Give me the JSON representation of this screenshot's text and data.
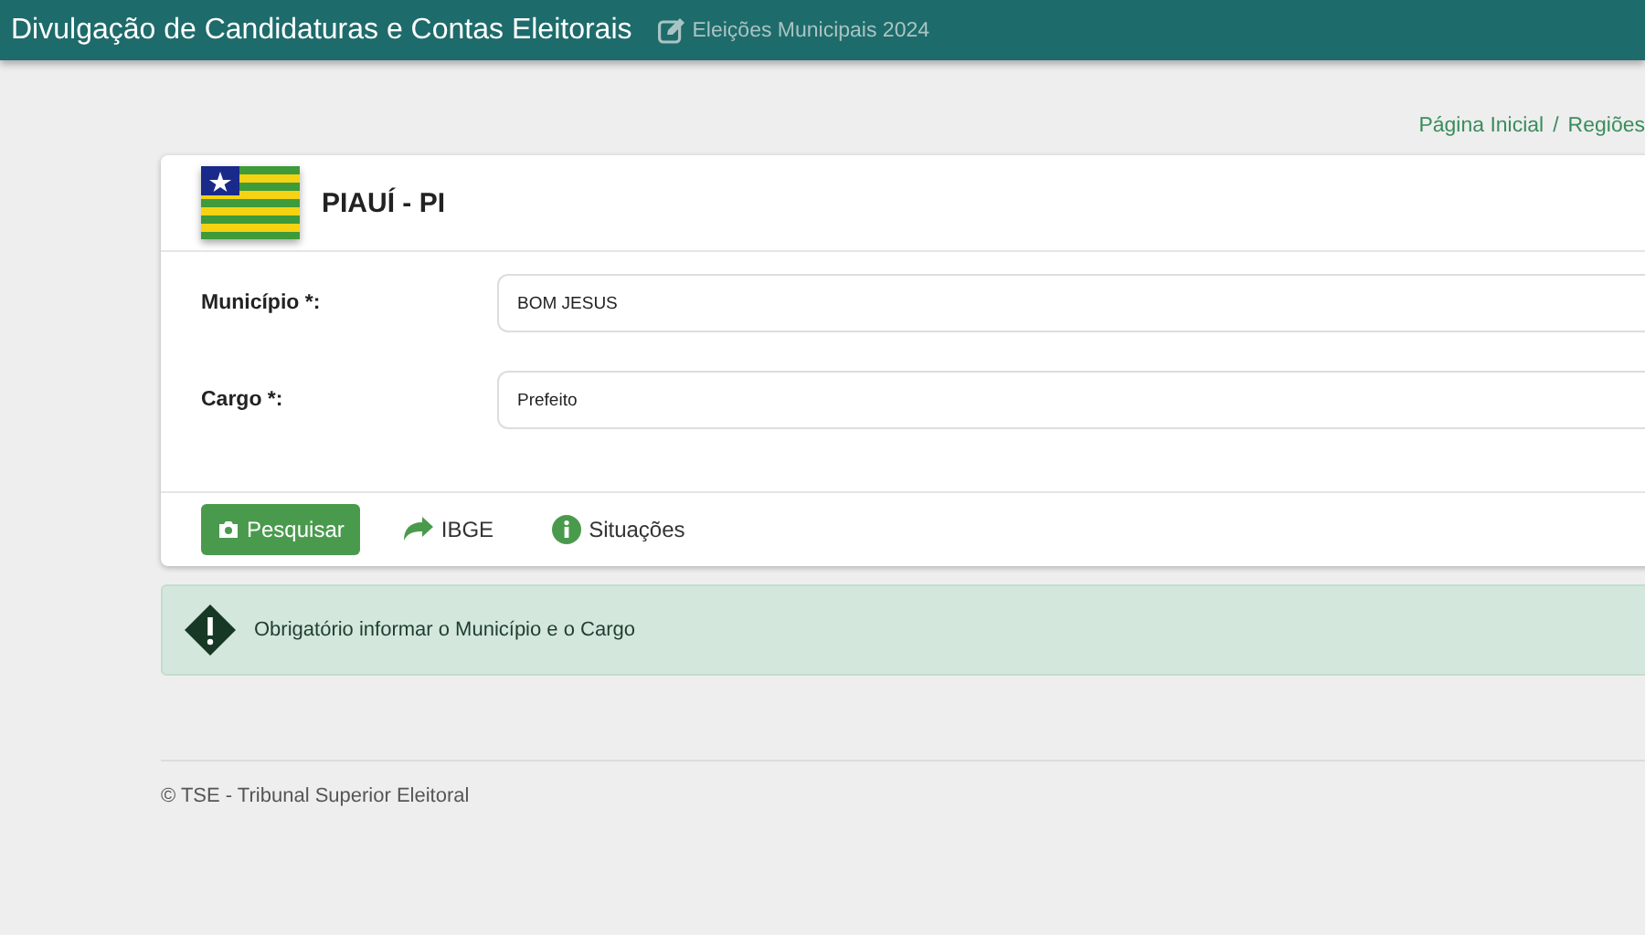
{
  "header": {
    "title": "Divulgação de Candidaturas e Contas Eleitorais",
    "subtitle": "Eleições Municipais 2024"
  },
  "breadcrumb": {
    "items": [
      "Página Inicial",
      "Regiões"
    ],
    "separator": "/"
  },
  "card": {
    "title": "PIAUÍ - PI",
    "fields": [
      {
        "label": "Município *:",
        "value": "BOM JESUS"
      },
      {
        "label": "Cargo *:",
        "value": "Prefeito"
      }
    ],
    "actions": [
      {
        "kind": "primary",
        "label": "Pesquisar"
      },
      {
        "kind": "share",
        "label": "IBGE"
      },
      {
        "kind": "info",
        "label": "Situações"
      }
    ]
  },
  "alert": {
    "message": "Obrigatório informar o Município e o Cargo"
  },
  "footer": {
    "text": "© TSE - Tribunal Superior Eleitoral"
  }
}
